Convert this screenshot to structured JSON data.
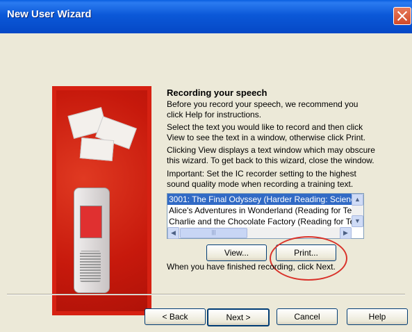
{
  "window": {
    "title": "New User Wizard"
  },
  "content": {
    "heading": "Recording your speech",
    "para1": [
      "Before you record your speech, we recommend you",
      "click Help for instructions."
    ],
    "para2": [
      "Select the text you would like to record and then click",
      "View to see the text in a window, otherwise click Print."
    ],
    "para3": [
      "Clicking View displays a text window which may obscure",
      "this wizard. To get back to this wizard, close the window."
    ],
    "para4": [
      "Important: Set the IC recorder setting to the highest",
      "sound quality mode when recording a training text."
    ],
    "list_items": [
      "3001: The Final Odyssey (Harder Reading: Science",
      "Alice's Adventures in Wonderland (Reading for Te",
      "Charlie and the Chocolate Factory (Reading for Te"
    ],
    "view_label": "View...",
    "print_label": "Print...",
    "finish_note": "When you have finished recording, click Next."
  },
  "footer": {
    "back_label": "< Back",
    "next_label": "Next >",
    "cancel_label": "Cancel",
    "help_label": "Help"
  },
  "colors": {
    "accent": "#d62112",
    "selection": "#316ac5",
    "highlight": "#d9322a"
  }
}
